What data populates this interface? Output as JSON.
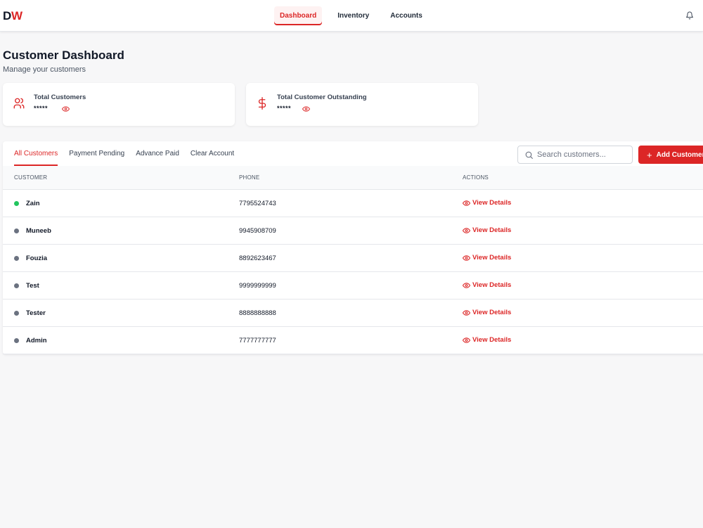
{
  "brand": {
    "part1": "D",
    "part2": "W"
  },
  "nav": {
    "items": [
      {
        "label": "Dashboard",
        "active": true
      },
      {
        "label": "Inventory",
        "active": false
      },
      {
        "label": "Accounts",
        "active": false
      }
    ]
  },
  "header": {
    "title": "Customer Dashboard",
    "subtitle": "Manage your customers"
  },
  "stats": [
    {
      "label": "Total Customers",
      "value": "*****",
      "icon": "users-icon"
    },
    {
      "label": "Total Customer Outstanding",
      "value": "*****",
      "icon": "dollar-icon"
    }
  ],
  "tabs": [
    {
      "label": "All Customers",
      "active": true
    },
    {
      "label": "Payment Pending",
      "active": false
    },
    {
      "label": "Advance Paid",
      "active": false
    },
    {
      "label": "Clear Account",
      "active": false
    }
  ],
  "search": {
    "placeholder": "Search customers..."
  },
  "add_button": {
    "label": "Add Customer"
  },
  "table": {
    "headers": {
      "customer": "CUSTOMER",
      "phone": "PHONE",
      "actions": "ACTIONS"
    },
    "action_label": "View Details",
    "rows": [
      {
        "name": "Zain",
        "phone": "7795524743",
        "status_color": "#22c55e"
      },
      {
        "name": "Muneeb",
        "phone": "9945908709",
        "status_color": "#6b7280"
      },
      {
        "name": "Fouzia",
        "phone": "8892623467",
        "status_color": "#6b7280"
      },
      {
        "name": "Test",
        "phone": "9999999999",
        "status_color": "#6b7280"
      },
      {
        "name": "Tester",
        "phone": "8888888888",
        "status_color": "#6b7280"
      },
      {
        "name": "Admin",
        "phone": "7777777777",
        "status_color": "#6b7280"
      }
    ]
  },
  "colors": {
    "accent": "#dc2626",
    "online": "#22c55e",
    "offline": "#6b7280"
  }
}
